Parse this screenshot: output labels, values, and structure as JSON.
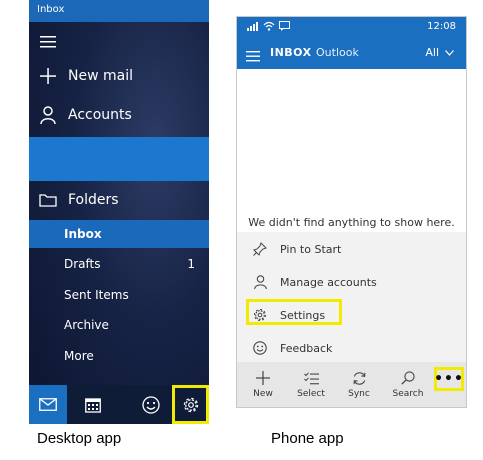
{
  "desktop": {
    "title": "Inbox",
    "new_mail": "New mail",
    "accounts": "Accounts",
    "folders_label": "Folders",
    "folders": [
      {
        "name": "Inbox",
        "count": "",
        "selected": true
      },
      {
        "name": "Drafts",
        "count": "1",
        "selected": false
      },
      {
        "name": "Sent Items",
        "count": "",
        "selected": false
      },
      {
        "name": "Archive",
        "count": "",
        "selected": false
      },
      {
        "name": "More",
        "count": "",
        "selected": false
      }
    ],
    "bottom_icons": [
      "mail-icon",
      "calendar-icon",
      "smiley-icon",
      "gear-icon"
    ]
  },
  "phone": {
    "status": {
      "time": "12:08"
    },
    "header": {
      "title": "INBOX",
      "account": "Outlook",
      "filter": "All"
    },
    "empty_message": "We didn't find anything to show here.",
    "menu": [
      {
        "label": "Pin to Start",
        "icon": "pin-icon"
      },
      {
        "label": "Manage accounts",
        "icon": "person-icon"
      },
      {
        "label": "Settings",
        "icon": "gear-icon"
      },
      {
        "label": "Feedback",
        "icon": "smiley-icon"
      }
    ],
    "appbar": [
      {
        "label": "New",
        "icon": "plus-icon"
      },
      {
        "label": "Select",
        "icon": "select-icon"
      },
      {
        "label": "Sync",
        "icon": "sync-icon"
      },
      {
        "label": "Search",
        "icon": "search-icon"
      }
    ],
    "more": "•••"
  },
  "captions": {
    "desktop": "Desktop app",
    "phone": "Phone app"
  },
  "colors": {
    "accent": "#1b6fc0",
    "highlight": "#f2ea00",
    "nav_dark": "#172345"
  }
}
